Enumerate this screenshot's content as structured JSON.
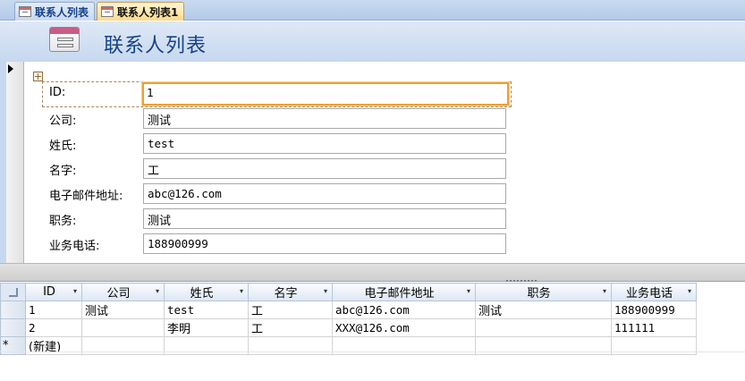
{
  "tabs": [
    {
      "label": "联系人列表",
      "active": false
    },
    {
      "label": "联系人列表1",
      "active": true
    }
  ],
  "form": {
    "title": "联系人列表",
    "icon": "form-icon",
    "record_selector_icon": "current-record-arrow-icon",
    "layout_icon": "layout-move-handle-icon"
  },
  "fields": [
    {
      "label": "ID:",
      "value": "1"
    },
    {
      "label": "公司:",
      "value": "测试"
    },
    {
      "label": "姓氏:",
      "value": "test"
    },
    {
      "label": "名字:",
      "value": "工"
    },
    {
      "label": "电子邮件地址:",
      "value": "abc@126.com"
    },
    {
      "label": "职务:",
      "value": "测试"
    },
    {
      "label": "业务电话:",
      "value": "188900999"
    }
  ],
  "datasheet": {
    "columns": [
      "ID",
      "公司",
      "姓氏",
      "名字",
      "电子邮件地址",
      "职务",
      "业务电话"
    ],
    "rows": [
      [
        "1",
        "测试",
        "test",
        "工",
        "abc@126.com",
        "测试",
        "188900999"
      ],
      [
        "2",
        "",
        "李明",
        "工",
        "XXX@126.com",
        "",
        "111111"
      ]
    ],
    "new_row_marker": "*",
    "new_row_label": "(新建)",
    "dropdown_glyph": "▾"
  },
  "colors": {
    "title": "#15428b",
    "focus_border": "#f0a030",
    "active_tab": "#ffd98a"
  }
}
